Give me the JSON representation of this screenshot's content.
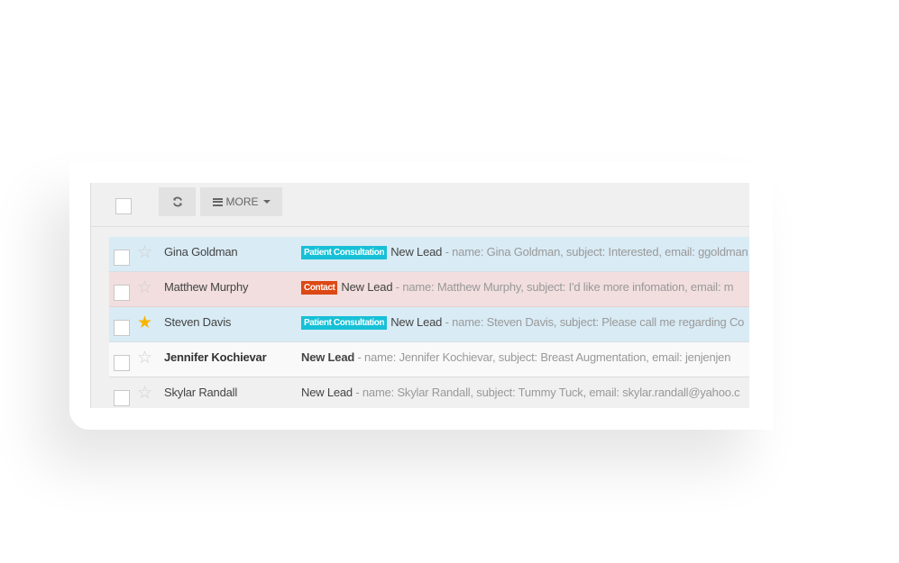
{
  "toolbar": {
    "select_all_checked": false,
    "refresh_icon": "refresh-icon",
    "more_icon": "list-icon",
    "more_label": "MORE"
  },
  "colors": {
    "row_blue": "#d9ebf5",
    "row_pink": "#f2dede",
    "badge_cyan": "#17c0d6",
    "badge_orange": "#dd4814",
    "star_active": "#f7b500"
  },
  "messages": [
    {
      "sender": "Gina Goldman",
      "starred": false,
      "badge": "Patient Consultation",
      "subject": "New Lead",
      "preview": " - name: Gina Goldman, subject: Interested, email: ggoldman"
    },
    {
      "sender": "Matthew Murphy",
      "starred": false,
      "badge": "Contact",
      "subject": "New Lead",
      "preview": " - name: Matthew Murphy, subject: I'd like more infomation, email: m"
    },
    {
      "sender": "Steven Davis",
      "starred": true,
      "badge": "Patient Consultation",
      "subject": "New Lead",
      "preview": " - name: Steven Davis, subject: Please call me regarding Co"
    },
    {
      "sender": "Jennifer Kochievar",
      "starred": false,
      "badge": "",
      "subject": "New Lead",
      "preview": " - name: Jennifer Kochievar, subject: Breast Augmentation, email: jenjenjen"
    },
    {
      "sender": "Skylar Randall",
      "starred": false,
      "badge": "",
      "subject": "New Lead",
      "preview": " - name: Skylar Randall, subject: Tummy Tuck, email: skylar.randall@yahoo.c"
    }
  ]
}
